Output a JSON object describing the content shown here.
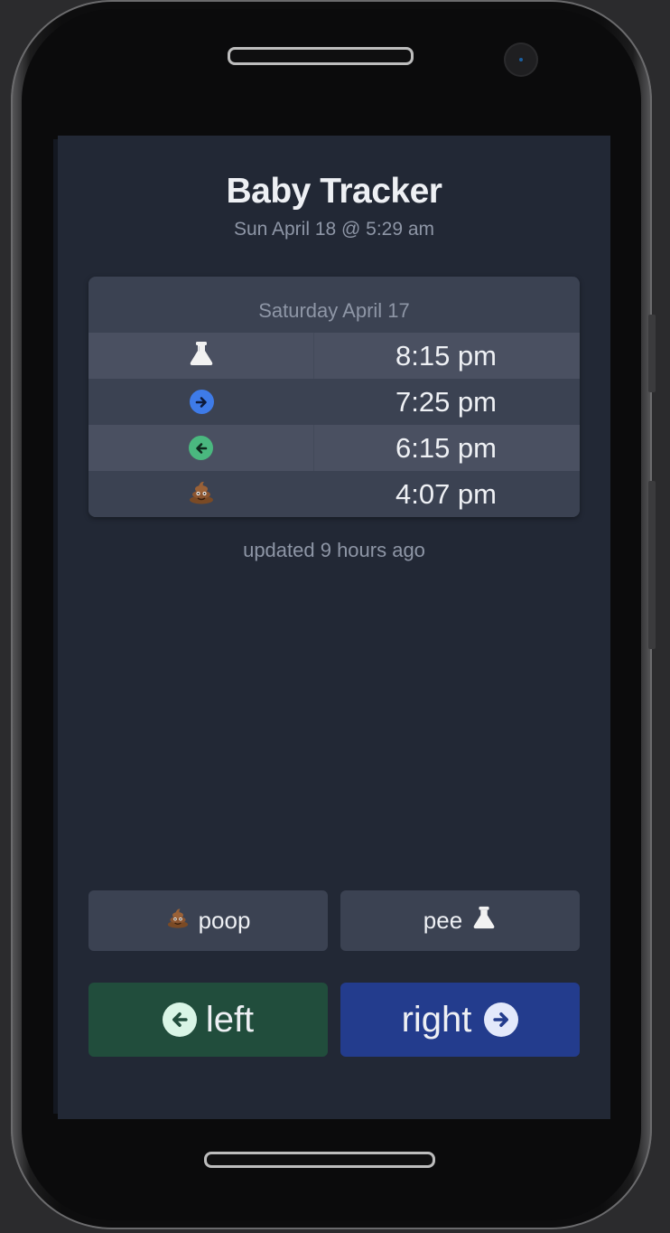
{
  "app": {
    "title": "Baby Tracker",
    "datetime": "Sun April 18 @ 5:29 am"
  },
  "log": {
    "day_label": "Saturday April 17",
    "entries": [
      {
        "icon": "flask-icon",
        "time": "8:15 pm"
      },
      {
        "icon": "arrow-right-circle-icon",
        "time": "7:25 pm"
      },
      {
        "icon": "arrow-left-circle-icon",
        "time": "6:15 pm"
      },
      {
        "icon": "poop-icon",
        "time": "4:07 pm"
      }
    ]
  },
  "status": {
    "updated": "updated 9 hours ago"
  },
  "actions": {
    "poop_label": "poop",
    "pee_label": "pee",
    "left_label": "left",
    "right_label": "right"
  },
  "colors": {
    "background": "#222835",
    "card": "#3b4252",
    "left_green": "#214d3c",
    "right_blue": "#233c8d",
    "right_icon_blue": "#3e7be8",
    "left_icon_green": "#4ab87f"
  }
}
